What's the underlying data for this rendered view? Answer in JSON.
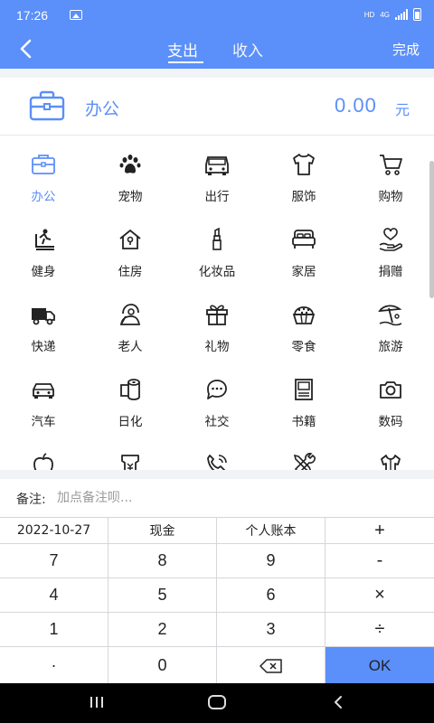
{
  "status": {
    "time": "17:26",
    "network_hd": "HD",
    "network_4g": "4G"
  },
  "header": {
    "tabs": [
      {
        "label": "支出"
      },
      {
        "label": "收入"
      }
    ],
    "done_label": "完成"
  },
  "selected": {
    "category": "办公",
    "amount": "0.00",
    "unit": "元"
  },
  "categories": [
    {
      "label": "办公",
      "icon": "briefcase-icon"
    },
    {
      "label": "宠物",
      "icon": "paw-icon"
    },
    {
      "label": "出行",
      "icon": "car-icon"
    },
    {
      "label": "服饰",
      "icon": "shirt-icon"
    },
    {
      "label": "购物",
      "icon": "cart-icon"
    },
    {
      "label": "健身",
      "icon": "treadmill-icon"
    },
    {
      "label": "住房",
      "icon": "house-icon"
    },
    {
      "label": "化妆品",
      "icon": "lipstick-icon"
    },
    {
      "label": "家居",
      "icon": "bed-icon"
    },
    {
      "label": "捐赠",
      "icon": "heart-hand-icon"
    },
    {
      "label": "快递",
      "icon": "truck-icon"
    },
    {
      "label": "老人",
      "icon": "elder-icon"
    },
    {
      "label": "礼物",
      "icon": "gift-icon"
    },
    {
      "label": "零食",
      "icon": "snack-icon"
    },
    {
      "label": "旅游",
      "icon": "umbrella-beach-icon"
    },
    {
      "label": "汽车",
      "icon": "auto-icon"
    },
    {
      "label": "日化",
      "icon": "tissue-roll-icon"
    },
    {
      "label": "社交",
      "icon": "chat-icon"
    },
    {
      "label": "书籍",
      "icon": "book-icon"
    },
    {
      "label": "数码",
      "icon": "camera-icon"
    },
    {
      "label": "",
      "icon": "apple-icon"
    },
    {
      "label": "",
      "icon": "money-bag-icon"
    },
    {
      "label": "",
      "icon": "phone-icon"
    },
    {
      "label": "",
      "icon": "tools-icon"
    },
    {
      "label": "",
      "icon": "clothes-hanger-icon"
    }
  ],
  "note": {
    "label": "备注:",
    "placeholder": "加点备注呗..."
  },
  "keypad": {
    "date": "2022-10-27",
    "account": "现金",
    "book": "个人账本",
    "plus": "+",
    "minus": "-",
    "times": "×",
    "divide": "÷",
    "digits": [
      "1",
      "2",
      "3",
      "4",
      "5",
      "6",
      "7",
      "8",
      "9",
      "0"
    ],
    "dot": "·",
    "ok": "OK"
  },
  "colors": {
    "accent": "#5b8ff9",
    "background": "#f2f3f7"
  }
}
